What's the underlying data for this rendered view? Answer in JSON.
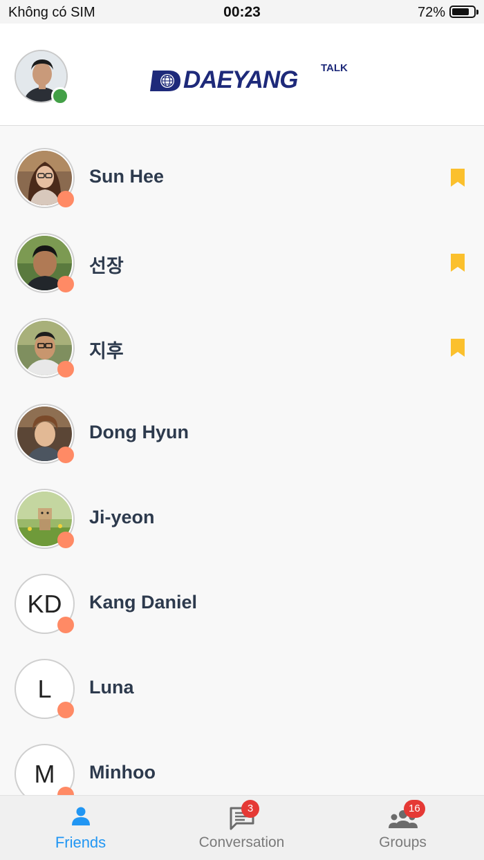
{
  "status_bar": {
    "carrier": "Không có SIM",
    "time": "00:23",
    "battery": "72%"
  },
  "header": {
    "logo": {
      "word": "DAEYANG",
      "talk": "TALK"
    },
    "me": {
      "online": true,
      "online_color": "#43a047"
    }
  },
  "colors": {
    "accent": "#2196f3",
    "bookmark": "#fbc02d",
    "away_dot": "#ff8a65",
    "badge": "#e53935",
    "name_text": "#2d3a4d"
  },
  "friends": [
    {
      "name": "Sun Hee",
      "avatar": "photo",
      "bookmarked": true
    },
    {
      "name": "선장",
      "avatar": "photo",
      "bookmarked": true
    },
    {
      "name": "지후",
      "avatar": "photo",
      "bookmarked": true
    },
    {
      "name": "Dong Hyun",
      "avatar": "photo",
      "bookmarked": false
    },
    {
      "name": "Ji-yeon",
      "avatar": "photo",
      "bookmarked": false
    },
    {
      "name": "Kang Daniel",
      "avatar": "initials",
      "initials": "KD",
      "bookmarked": false
    },
    {
      "name": "Luna",
      "avatar": "initials",
      "initials": "L",
      "bookmarked": false
    },
    {
      "name": "Minhoo",
      "avatar": "initials",
      "initials": "M",
      "bookmarked": false
    }
  ],
  "tabs": [
    {
      "label": "Friends",
      "icon": "person-icon",
      "active": true
    },
    {
      "label": "Conversation",
      "icon": "chat-icon",
      "badge": "3"
    },
    {
      "label": "Groups",
      "icon": "group-icon",
      "badge": "16"
    }
  ]
}
